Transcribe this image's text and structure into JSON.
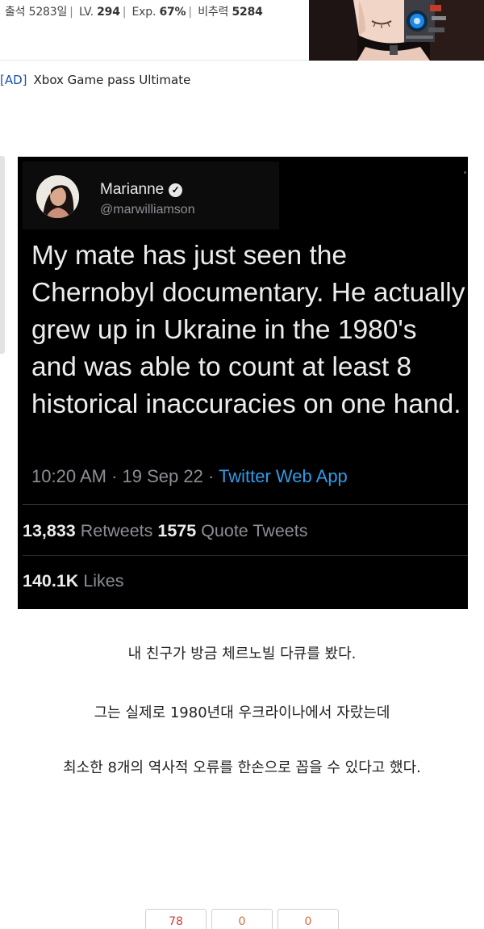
{
  "user_stats": {
    "attendance_label": "출석",
    "attendance_value": "5283일",
    "level_label": "LV.",
    "level_value": "294",
    "exp_label": "Exp.",
    "exp_value": "67%",
    "ratio_label": "비추력",
    "ratio_value": "5284"
  },
  "ad": {
    "tag": "[AD]",
    "text": "Xbox Game pass Ultimate"
  },
  "tweet": {
    "name": "Marianne",
    "handle": "@marwilliamson",
    "body": "My mate has just seen the Chernobyl documentary. He actually grew up in Ukraine in the 1980's and was able to count at least 8 historical inaccuracies on one hand.",
    "time": "10:20 AM",
    "date": "19 Sep 22",
    "source": "Twitter Web App",
    "retweets_count": "13,833",
    "retweets_label": "Retweets",
    "quotes_count": "1575",
    "quotes_label": "Quote Tweets",
    "likes_count": "140.1K",
    "likes_label": "Likes"
  },
  "translation": [
    "내 친구가 방금 체르노빌 다큐를 봤다.",
    "그는 실제로 1980년대 우크라이나에서 자랐는데",
    "최소한 8개의 역사적 오류를 한손으로 꼽을 수 있다고 했다."
  ],
  "votes": {
    "up": "78",
    "down": "0",
    "other": "0"
  },
  "colors": {
    "ad_tag": "#1a4fa8",
    "tweet_bg": "#000000",
    "link_blue": "#2f9be8",
    "vote_up": "#d23c3c"
  }
}
